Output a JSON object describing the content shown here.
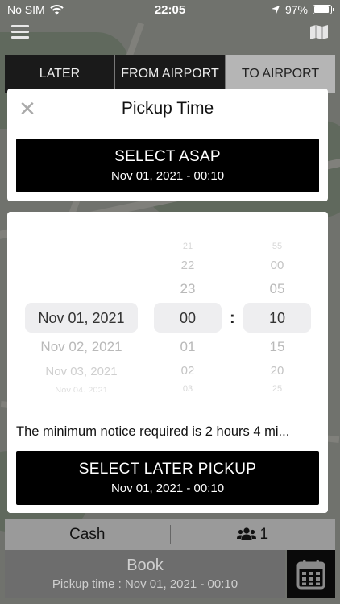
{
  "status_bar": {
    "carrier": "No SIM",
    "time": "22:05",
    "battery": "97%"
  },
  "tabs": [
    {
      "label": "LATER"
    },
    {
      "label": "FROM AIRPORT"
    },
    {
      "label": "TO AIRPORT"
    }
  ],
  "dialog": {
    "title": "Pickup Time",
    "asap_button": {
      "label": "SELECT ASAP",
      "datetime": "Nov 01, 2021 - 00:10"
    }
  },
  "picker": {
    "dates": {
      "above": [],
      "selected": "Nov 01, 2021",
      "below": [
        "Nov 02, 2021",
        "Nov 03, 2021",
        "Nov 04, 2021"
      ]
    },
    "hours": {
      "above": [
        "21",
        "22",
        "23"
      ],
      "selected": "00",
      "below": [
        "01",
        "02",
        "03"
      ]
    },
    "minutes": {
      "above": [
        "55",
        "00",
        "05"
      ],
      "selected": "10",
      "below": [
        "15",
        "20",
        "25"
      ]
    },
    "separator": ":"
  },
  "notice": "The minimum notice required is 2 hours 4 mi...",
  "later_button": {
    "label": "SELECT LATER PICKUP",
    "datetime": "Nov 01, 2021 - 00:10"
  },
  "payment": {
    "method": "Cash",
    "passengers": "1"
  },
  "book": {
    "label": "Book",
    "pickup_time": "Pickup time : Nov 01, 2021 - 00:10"
  },
  "icons": [
    "wifi-icon",
    "location-arrow-icon",
    "battery-icon",
    "hamburger-menu-icon",
    "map-icon",
    "close-icon",
    "users-icon",
    "calendar-icon"
  ]
}
